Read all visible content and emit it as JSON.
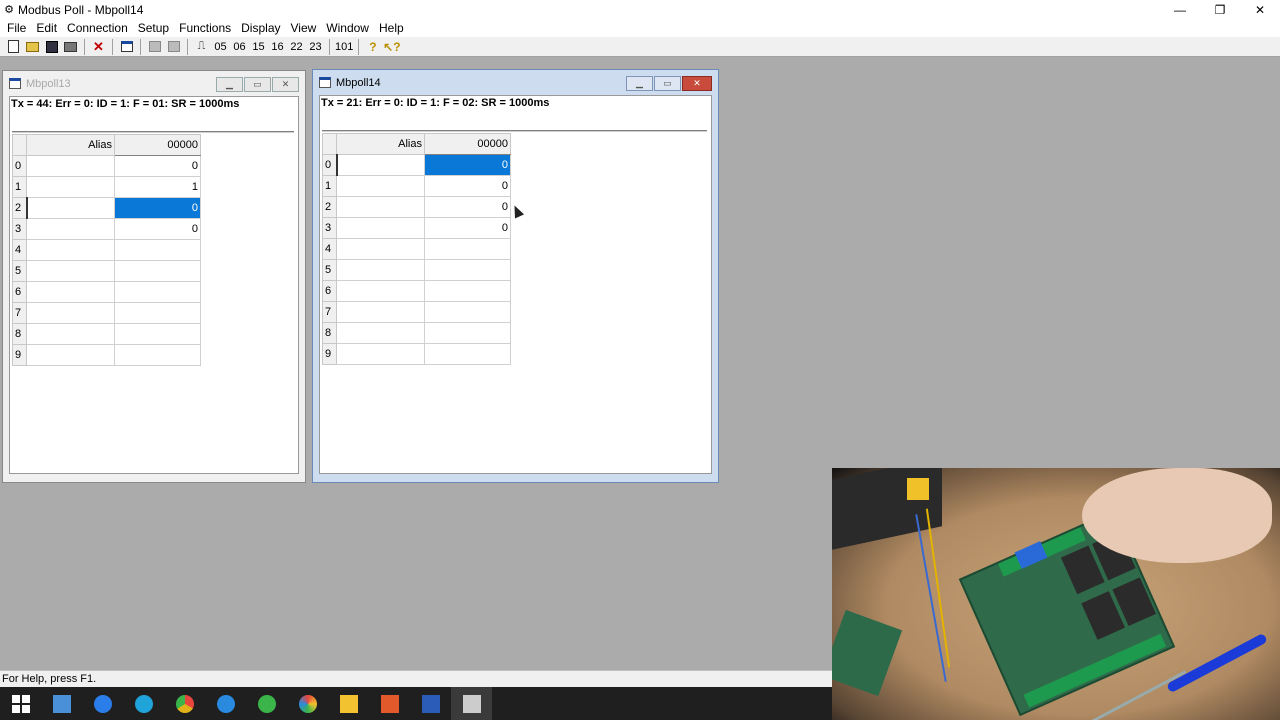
{
  "app": {
    "title": "Modbus Poll - Mbpoll14",
    "controls": {
      "minimize": "—",
      "restore": "❐",
      "close": "✕"
    }
  },
  "menu": [
    "File",
    "Edit",
    "Connection",
    "Setup",
    "Functions",
    "Display",
    "View",
    "Window",
    "Help"
  ],
  "toolbar": {
    "fn_labels": [
      "05",
      "06",
      "15",
      "16",
      "22",
      "23"
    ],
    "read_label": "101",
    "icons": [
      "new-icon",
      "open-icon",
      "save-icon",
      "print-icon",
      "delete-icon",
      "window-icon",
      "connect-icon",
      "disconnect-icon",
      "pulse-icon",
      "help-icon",
      "context-help-icon"
    ]
  },
  "windows": [
    {
      "title": "Mbpoll13",
      "status": "Tx = 44: Err = 0: ID = 1: F = 01: SR = 1000ms",
      "columns": {
        "alias": "Alias",
        "address": "00000"
      },
      "rows": [
        {
          "index": "0",
          "alias": "",
          "value": "0"
        },
        {
          "index": "1",
          "alias": "",
          "value": "1"
        },
        {
          "index": "2",
          "alias": "",
          "value": "0"
        },
        {
          "index": "3",
          "alias": "",
          "value": "0"
        },
        {
          "index": "4",
          "alias": "",
          "value": ""
        },
        {
          "index": "5",
          "alias": "",
          "value": ""
        },
        {
          "index": "6",
          "alias": "",
          "value": ""
        },
        {
          "index": "7",
          "alias": "",
          "value": ""
        },
        {
          "index": "8",
          "alias": "",
          "value": ""
        },
        {
          "index": "9",
          "alias": "",
          "value": ""
        }
      ],
      "selected_row": 2
    },
    {
      "title": "Mbpoll14",
      "status": "Tx = 21: Err = 0: ID = 1: F = 02: SR = 1000ms",
      "columns": {
        "alias": "Alias",
        "address": "00000"
      },
      "rows": [
        {
          "index": "0",
          "alias": "",
          "value": "0"
        },
        {
          "index": "1",
          "alias": "",
          "value": "0"
        },
        {
          "index": "2",
          "alias": "",
          "value": "0"
        },
        {
          "index": "3",
          "alias": "",
          "value": "0"
        },
        {
          "index": "4",
          "alias": "",
          "value": ""
        },
        {
          "index": "5",
          "alias": "",
          "value": ""
        },
        {
          "index": "6",
          "alias": "",
          "value": ""
        },
        {
          "index": "7",
          "alias": "",
          "value": ""
        },
        {
          "index": "8",
          "alias": "",
          "value": ""
        },
        {
          "index": "9",
          "alias": "",
          "value": ""
        }
      ],
      "selected_row": 0
    }
  ],
  "statusbar": {
    "text": "For Help, press F1."
  },
  "taskbar": {
    "items": [
      {
        "name": "start-icon",
        "color": "#ffffff"
      },
      {
        "name": "calculator-icon",
        "color": "#4a90d9"
      },
      {
        "name": "browser-icon",
        "color": "#2b7de9"
      },
      {
        "name": "edge-icon",
        "color": "#1fa3d8"
      },
      {
        "name": "chrome-icon",
        "color": "#e2b21b"
      },
      {
        "name": "search-app-icon",
        "color": "#2a8ae0"
      },
      {
        "name": "green-app-icon",
        "color": "#3bb54a"
      },
      {
        "name": "color-app-icon",
        "color": "#e8463c"
      },
      {
        "name": "file-explorer-icon",
        "color": "#f2c230"
      },
      {
        "name": "office-icon",
        "color": "#e25a2c"
      },
      {
        "name": "word-icon",
        "color": "#2b5cb8"
      },
      {
        "name": "modbus-poll-icon",
        "color": "#cccccc"
      }
    ]
  },
  "colors": {
    "selection": "#0a78d7",
    "workspace": "#ababab",
    "taskbar": "#1f1f1f"
  }
}
